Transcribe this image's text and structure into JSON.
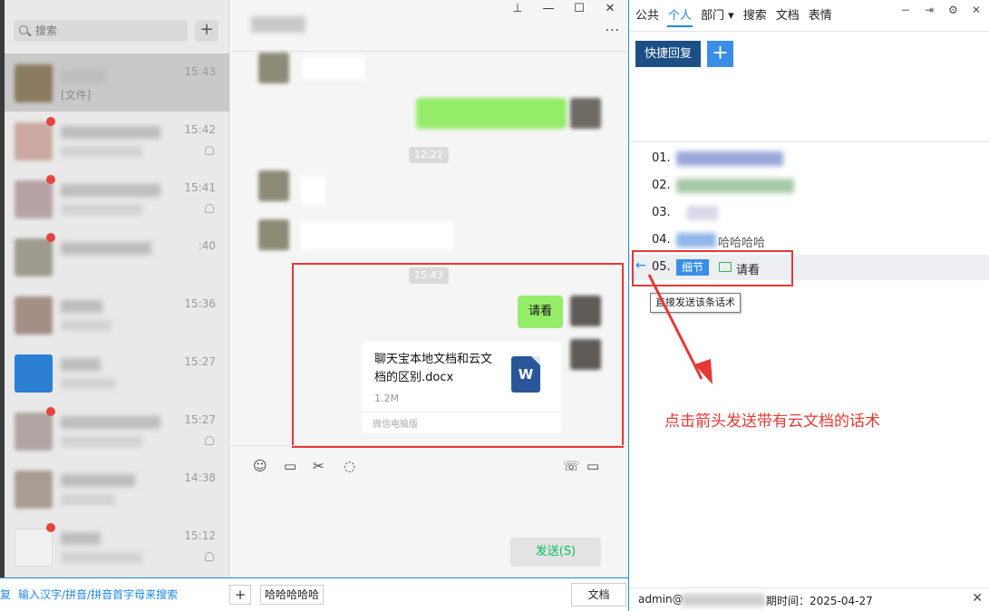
{
  "sidebar": {
    "search_placeholder": "搜索",
    "add_label": "+",
    "chats": [
      {
        "time": "15:43",
        "preview": "[文件]"
      },
      {
        "time": "15:42"
      },
      {
        "time": "15:41"
      },
      {
        "time": ":40"
      },
      {
        "time": "15:36"
      },
      {
        "time": "15:27"
      },
      {
        "time": "15:27"
      },
      {
        "time": "14:38"
      },
      {
        "time": "15:12"
      }
    ]
  },
  "chat": {
    "more_label": "···",
    "times": [
      "12:21",
      "15:43"
    ],
    "reply_text": "请看",
    "file": {
      "name": "聊天宝本地文档和云文档的区别.docx",
      "size": "1.2M",
      "source": "微信电脑版",
      "icon_letter": "W"
    },
    "send_label": "发送(S)"
  },
  "right": {
    "tabs": [
      "公共",
      "个人",
      "部门",
      "搜索",
      "文档",
      "表情"
    ],
    "active_tab": "个人",
    "quick_reply_label": "快捷回复",
    "add_label": "+",
    "items": [
      {
        "num": "01."
      },
      {
        "num": "02."
      },
      {
        "num": "03."
      },
      {
        "num": "04.",
        "tail": "哈哈哈哈"
      },
      {
        "num": "05.",
        "tag": "细节",
        "text": "请看"
      }
    ],
    "tooltip": "直接发送该条话术",
    "annotation": "点击箭头发送带有云文档的话术",
    "footer": {
      "admin": "admin@",
      "expiry": "期时间：2025-04-27",
      "close": "✕"
    }
  },
  "bottom": {
    "left_cut": "复",
    "input_placeholder": "输入汉字/拼音/拼音首字母来搜索",
    "plus": "+",
    "chip": "哈哈哈哈哈",
    "doc": "文档"
  },
  "colors": {
    "accent": "#1e88e5",
    "wechat_green": "#95ec69",
    "annotation_red": "#e53935"
  }
}
